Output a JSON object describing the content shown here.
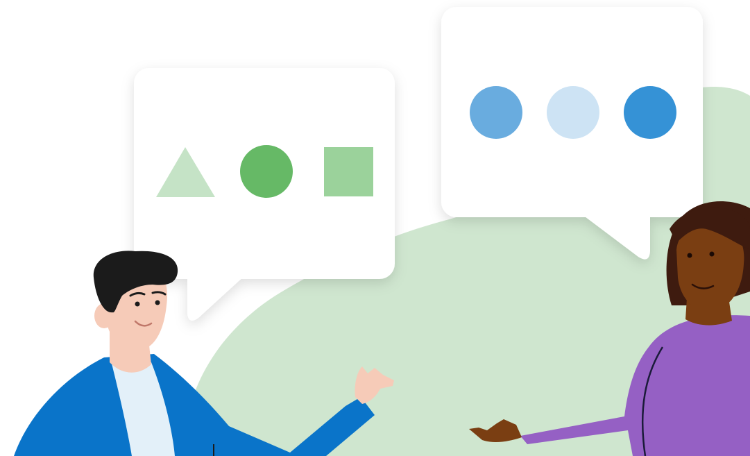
{
  "colors": {
    "background": "#ffffff",
    "blob_green": "#cfe6cf",
    "bubble": "#ffffff",
    "shape_triangle": "#c5e3c6",
    "shape_circle": "#66b966",
    "shape_square": "#9bd29b",
    "dot_left": "#69acdf",
    "dot_middle": "#cde3f4",
    "dot_right": "#3592d6",
    "man_jacket": "#0a74c9",
    "man_shirt": "#e3f0f9",
    "man_skin": "#f6cbb8",
    "man_hair": "#1b1b1b",
    "woman_top": "#9560c4",
    "woman_skin": "#7a3e12",
    "woman_hair": "#3e1b0f"
  },
  "left_bubble": {
    "shapes": [
      "triangle-icon",
      "circle-icon",
      "square-icon"
    ]
  },
  "right_bubble": {
    "dots": [
      "dot-left",
      "dot-middle",
      "dot-right"
    ]
  },
  "people": [
    "man-illustration",
    "woman-illustration"
  ]
}
